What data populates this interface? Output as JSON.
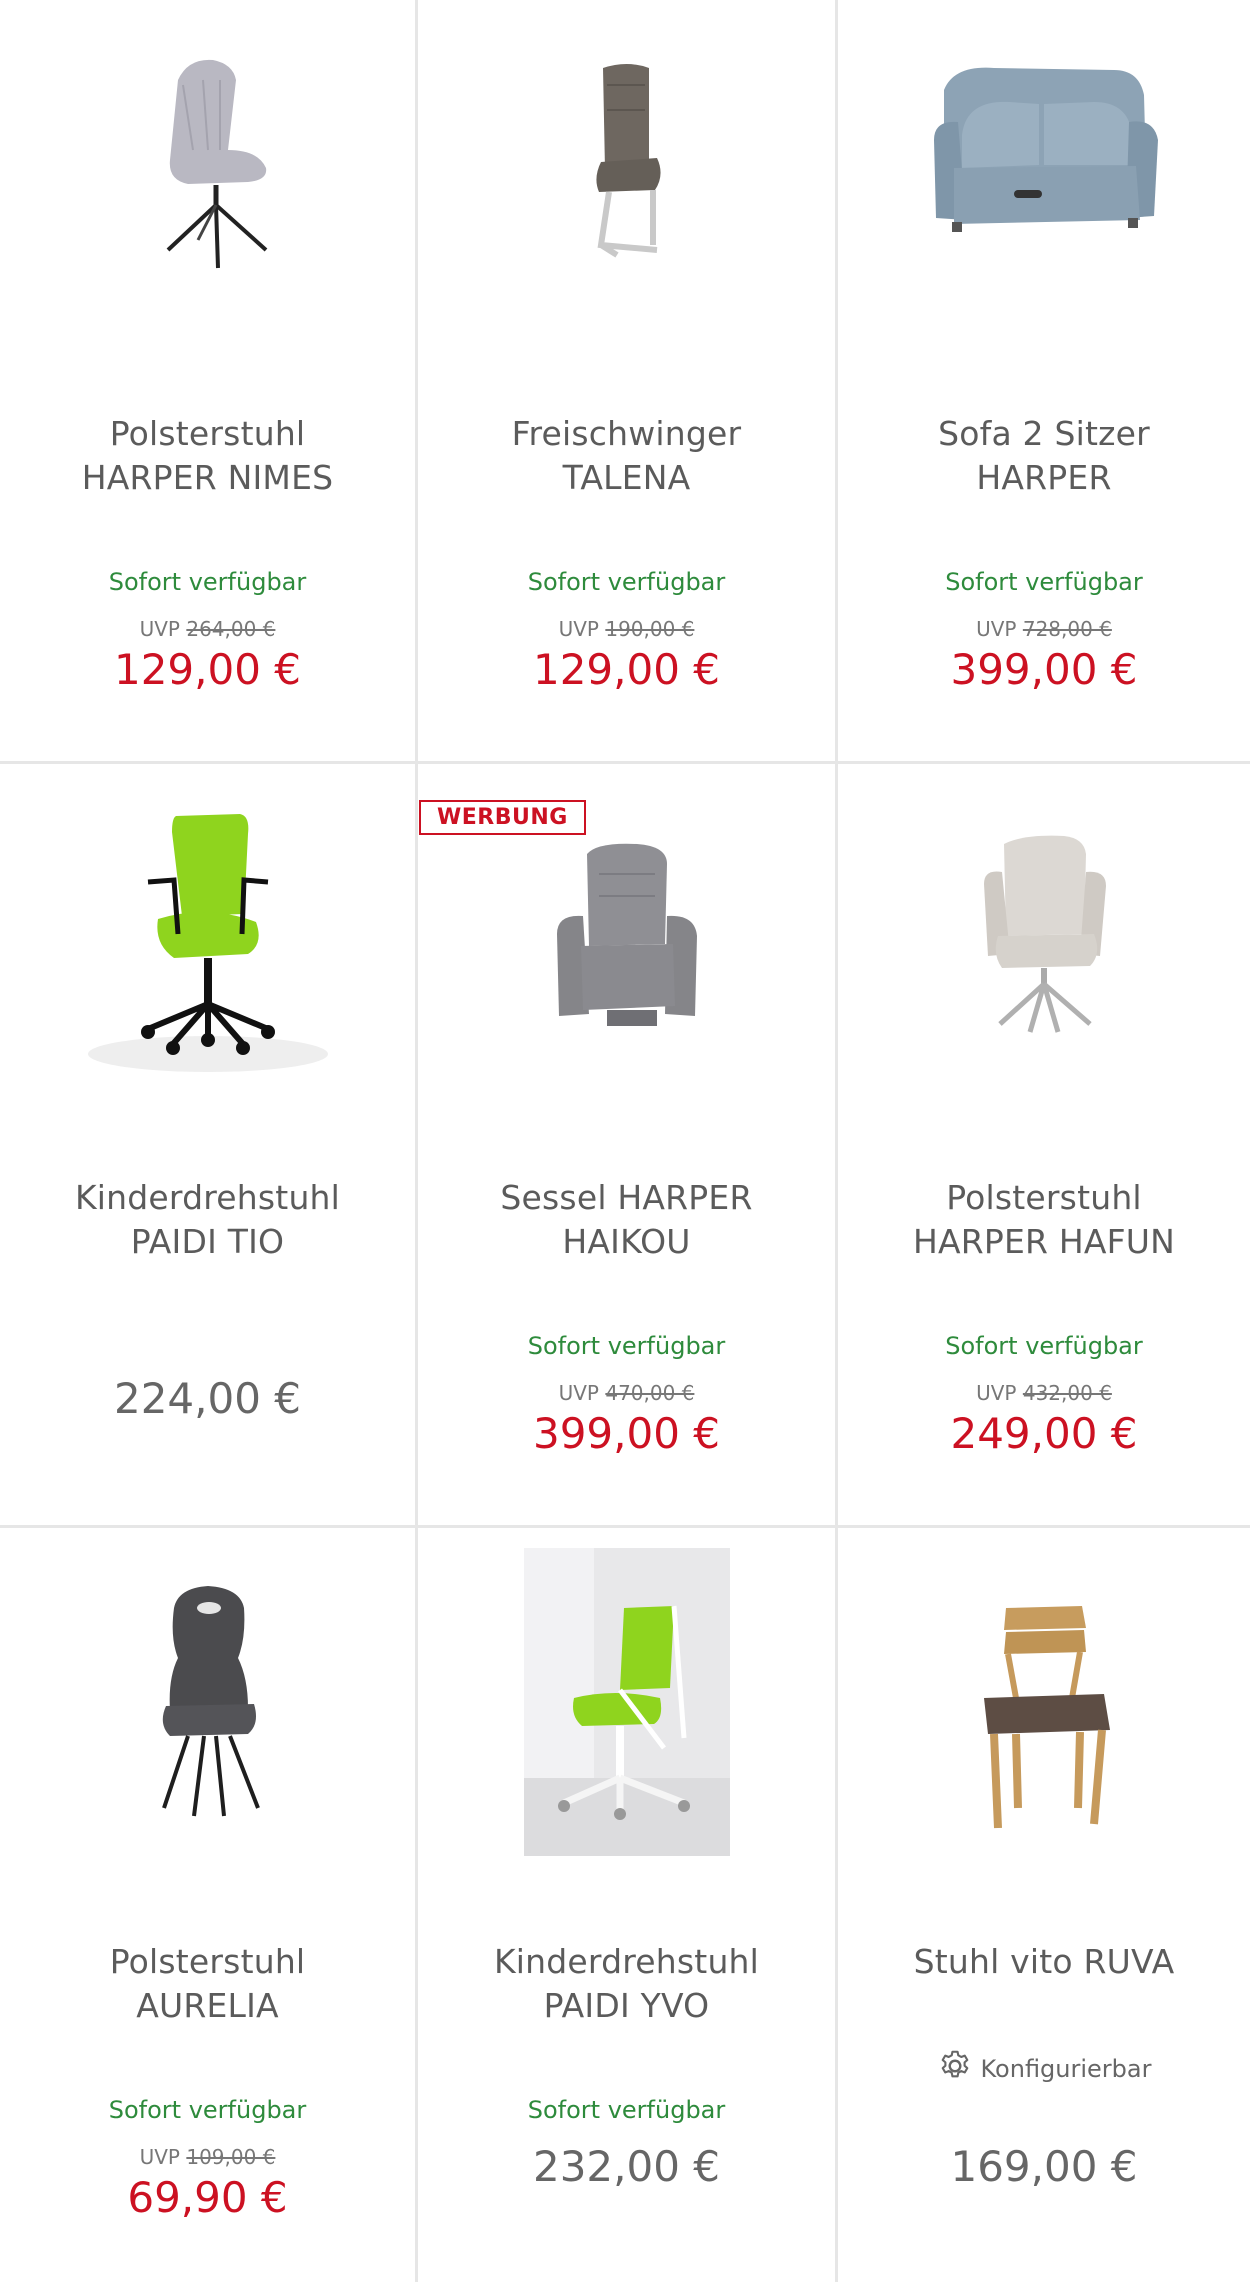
{
  "products": [
    {
      "title1": "Polsterstuhl",
      "title2": "HARPER NIMES",
      "availability": "Sofort verfügbar",
      "uvp_label": "UVP",
      "uvp_price": "264,00 €",
      "price": "129,00 €"
    },
    {
      "title1": "Freischwinger",
      "title2": "TALENA",
      "availability": "Sofort verfügbar",
      "uvp_label": "UVP",
      "uvp_price": "190,00 €",
      "price": "129,00 €"
    },
    {
      "title1": "Sofa 2 Sitzer",
      "title2": "HARPER",
      "availability": "Sofort verfügbar",
      "uvp_label": "UVP",
      "uvp_price": "728,00 €",
      "price": "399,00 €"
    },
    {
      "title1": "Kinderdrehstuhl",
      "title2": "PAIDI TIO",
      "price": "224,00 €"
    },
    {
      "badge": "WERBUNG",
      "title1": "Sessel HARPER",
      "title2": "HAIKOU",
      "availability": "Sofort verfügbar",
      "uvp_label": "UVP",
      "uvp_price": "470,00 €",
      "price": "399,00 €"
    },
    {
      "title1": "Polsterstuhl",
      "title2": "HARPER HAFUN",
      "availability": "Sofort verfügbar",
      "uvp_label": "UVP",
      "uvp_price": "432,00 €",
      "price": "249,00 €"
    },
    {
      "title1": "Polsterstuhl",
      "title2": "AURELIA",
      "availability": "Sofort verfügbar",
      "uvp_label": "UVP",
      "uvp_price": "109,00 €",
      "price": "69,90 €"
    },
    {
      "title1": "Kinderdrehstuhl",
      "title2": "PAIDI YVO",
      "availability": "Sofort verfügbar",
      "price": "232,00 €"
    },
    {
      "title1": "Stuhl vito RUVA",
      "configurable": "Konfigurierbar",
      "price": "169,00 €"
    }
  ],
  "icons": {
    "config": "gear-icon"
  },
  "colors": {
    "sale_price": "#cc1122",
    "availability": "#2e8b3c",
    "badge": "#cc1122",
    "regular_price": "#666666"
  }
}
